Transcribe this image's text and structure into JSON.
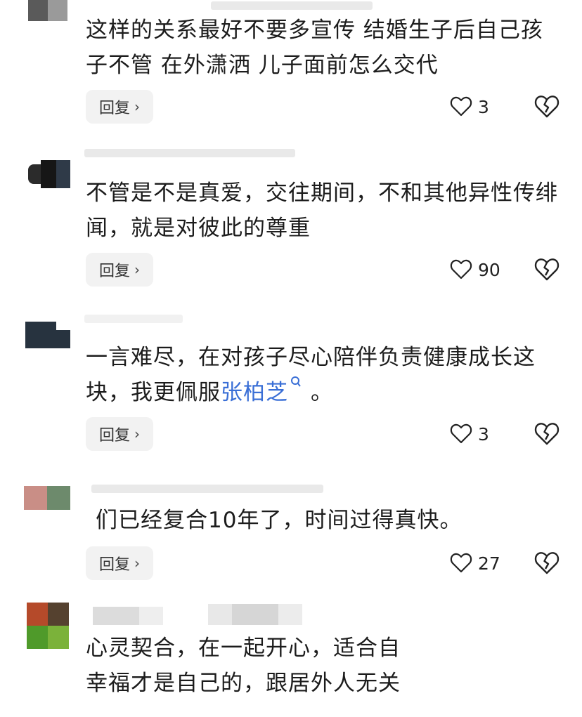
{
  "comments": [
    {
      "text": "这样的关系最好不要多宣传 结婚生子后自己孩子不管 在外潇洒 儿子面前怎么交代",
      "reply_label": "回复",
      "likes": "3"
    },
    {
      "text": "不管是不是真爱，交往期间，不和其他异性传绯闻，就是对彼此的尊重",
      "reply_label": "回复",
      "likes": "90"
    },
    {
      "text_before": "一言难尽，在对孩子尽心陪伴负责健康成长这块，我更佩服",
      "mention": "张柏芝",
      "text_after": "。",
      "reply_label": "回复",
      "likes": "3"
    },
    {
      "text": "们已经复合10年了，时间过得真快。",
      "reply_label": "回复",
      "likes": "27"
    },
    {
      "text_line1": "心灵契合，在一起开心，适合自",
      "text_line2": "幸福才是自己的，跟居外人无关"
    }
  ],
  "colors": {
    "mention": "#3a6fd6",
    "reply_bg": "#f2f2f2"
  },
  "icons": {
    "like": "heart-outline-icon",
    "dislike": "broken-heart-icon",
    "search": "search-icon",
    "chevron": "chevron-right-icon"
  }
}
